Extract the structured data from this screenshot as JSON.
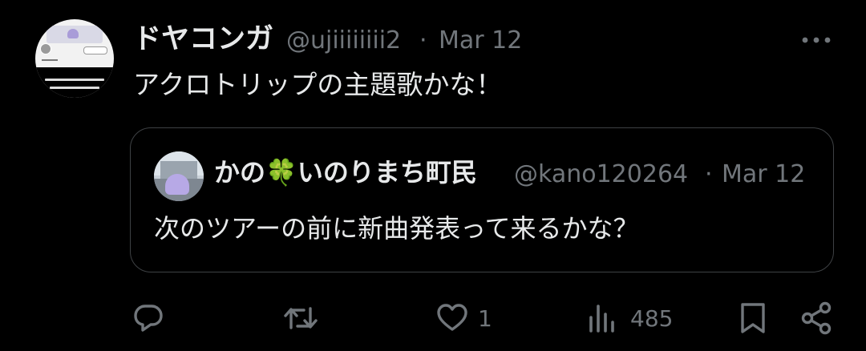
{
  "tweet": {
    "author_name": "ドヤコンガ",
    "author_handle": "@ujiiiiiiii2",
    "separator": "·",
    "date": "Mar 12",
    "text": "アクロトリップの主題歌かな！"
  },
  "quote": {
    "author_name_prefix": "かの",
    "author_name_emoji": "🍀",
    "author_name_suffix": "いのりまち町民",
    "author_handle": "@kano120264",
    "separator": "·",
    "date": "Mar 12",
    "text": "次のツアーの前に新曲発表って来るかな？"
  },
  "actions": {
    "replies": "",
    "reposts": "",
    "likes": "1",
    "views": "485"
  },
  "icons": {
    "more": "more-icon",
    "reply": "reply-icon",
    "repost": "repost-icon",
    "like": "like-icon",
    "views": "views-icon",
    "bookmark": "bookmark-icon",
    "share": "share-icon"
  },
  "colors": {
    "background": "#000000",
    "primary_text": "#e7e9ea",
    "secondary_text": "#71767b",
    "border": "#3e4144",
    "clover": "#3aa84a"
  }
}
